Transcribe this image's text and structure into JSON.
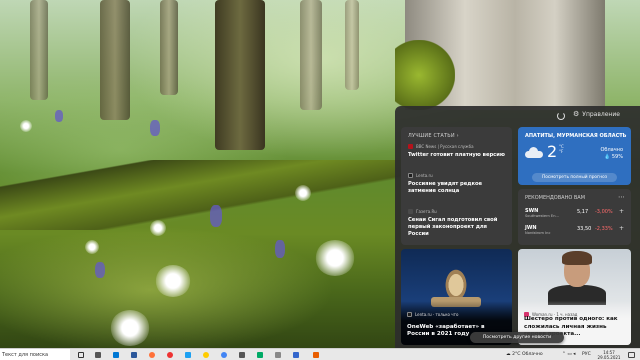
{
  "panel": {
    "manage_label": "Управление",
    "top_stories": {
      "title": "ЛУЧШИЕ СТАТЬИ  ›",
      "stories": [
        {
          "source": "BBC News | Русская служба",
          "headline": "Twitter готовит платную версию",
          "logo_color": "#b5121b"
        },
        {
          "source": "Lenta.ru",
          "headline": "Россияне увидят редкое затмение солнца",
          "logo_color": "#1f1f1f"
        },
        {
          "source": "Газета.Ru",
          "headline": "Сенаи Сигал подготовил свой первый законопроект для России",
          "logo_color": "#4a4a4a"
        }
      ]
    },
    "weather": {
      "location": "АПАТИТЫ, МУРМАНСКАЯ ОБЛАСТЬ",
      "temperature": "2",
      "unit_c": "°C",
      "unit_f": "°F",
      "condition": "Облачно",
      "precip": "💧 59%",
      "button": "Посмотреть полный прогноз"
    },
    "stocks": {
      "title": "РЕКОМЕНДОВАНО ВАМ",
      "rows": [
        {
          "symbol": "SWN",
          "company": "Southwestern En...",
          "price": "5,17",
          "change": "-3,00%"
        },
        {
          "symbol": "JWN",
          "company": "Nordstrom Inc",
          "price": "33,50",
          "change": "-2,33%"
        }
      ]
    },
    "image_cards": [
      {
        "source": "Lenta.ru · только что",
        "headline": "OneWeb «заработает» в России в 2021 году"
      },
      {
        "source": "Woman.ru · 1 ч. назад",
        "headline": "Шестеро против одного: как сложилась личная жизнь героев проекта..."
      }
    ],
    "more_news_button": "Посмотреть другие новости"
  },
  "taskbar": {
    "search_text": "Текст для поиска",
    "temp": "2°C",
    "weather": "Облачно",
    "lang": "РУС",
    "time": "14:57",
    "date": "29.05.2021"
  },
  "colors": {
    "weather_card": "#2f6fc0",
    "negative_change": "#ff6b6b",
    "panel_bg": "#2c2c2c"
  }
}
